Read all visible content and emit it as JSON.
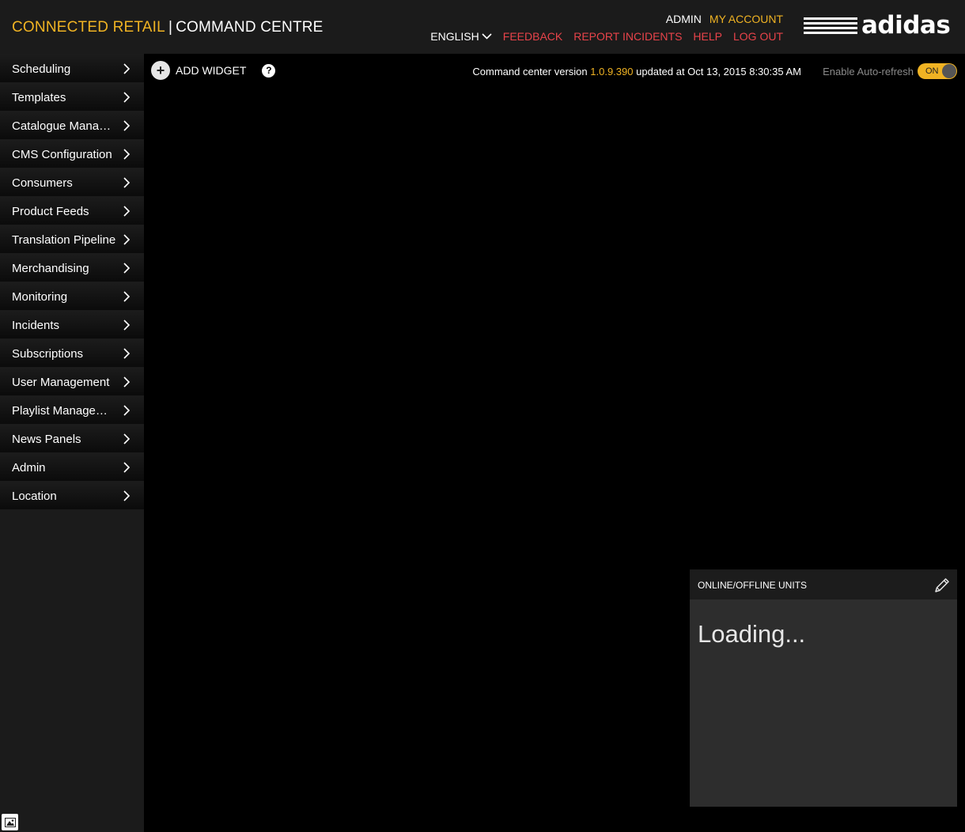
{
  "header": {
    "brand_primary": "CONNECTED RETAIL",
    "brand_separator": "|",
    "brand_secondary": "COMMAND CENTRE",
    "admin_label": "ADMIN",
    "my_account": "MY ACCOUNT",
    "language": "ENGLISH",
    "links": {
      "feedback": "FEEDBACK",
      "report_incidents": "REPORT INCIDENTS",
      "help": "HELP",
      "logout": "LOG OUT"
    },
    "logo_text": "adidas"
  },
  "sidebar": {
    "items": [
      {
        "label": "Scheduling"
      },
      {
        "label": "Templates"
      },
      {
        "label": "Catalogue Management"
      },
      {
        "label": "CMS Configuration"
      },
      {
        "label": "Consumers"
      },
      {
        "label": "Product Feeds"
      },
      {
        "label": "Translation Pipeline"
      },
      {
        "label": "Merchandising"
      },
      {
        "label": "Monitoring"
      },
      {
        "label": "Incidents"
      },
      {
        "label": "Subscriptions"
      },
      {
        "label": "User Management"
      },
      {
        "label": "Playlist Management"
      },
      {
        "label": "News Panels"
      },
      {
        "label": "Admin"
      },
      {
        "label": "Location"
      }
    ]
  },
  "toolbar": {
    "add_widget": "ADD WIDGET",
    "add_icon": "+",
    "help_icon": "?"
  },
  "version": {
    "prefix": "Command center version",
    "number": "1.0.9.390",
    "suffix": "updated at Oct 13, 2015 8:30:35 AM"
  },
  "autorefresh": {
    "label": "Enable Auto-refresh",
    "state": "ON"
  },
  "widget": {
    "title": "ONLINE/OFFLINE UNITS",
    "status": "Loading..."
  },
  "colors": {
    "accent": "#f0b323",
    "link_red": "#e8434a",
    "background": "#000000",
    "panel": "#1b1b1b"
  }
}
